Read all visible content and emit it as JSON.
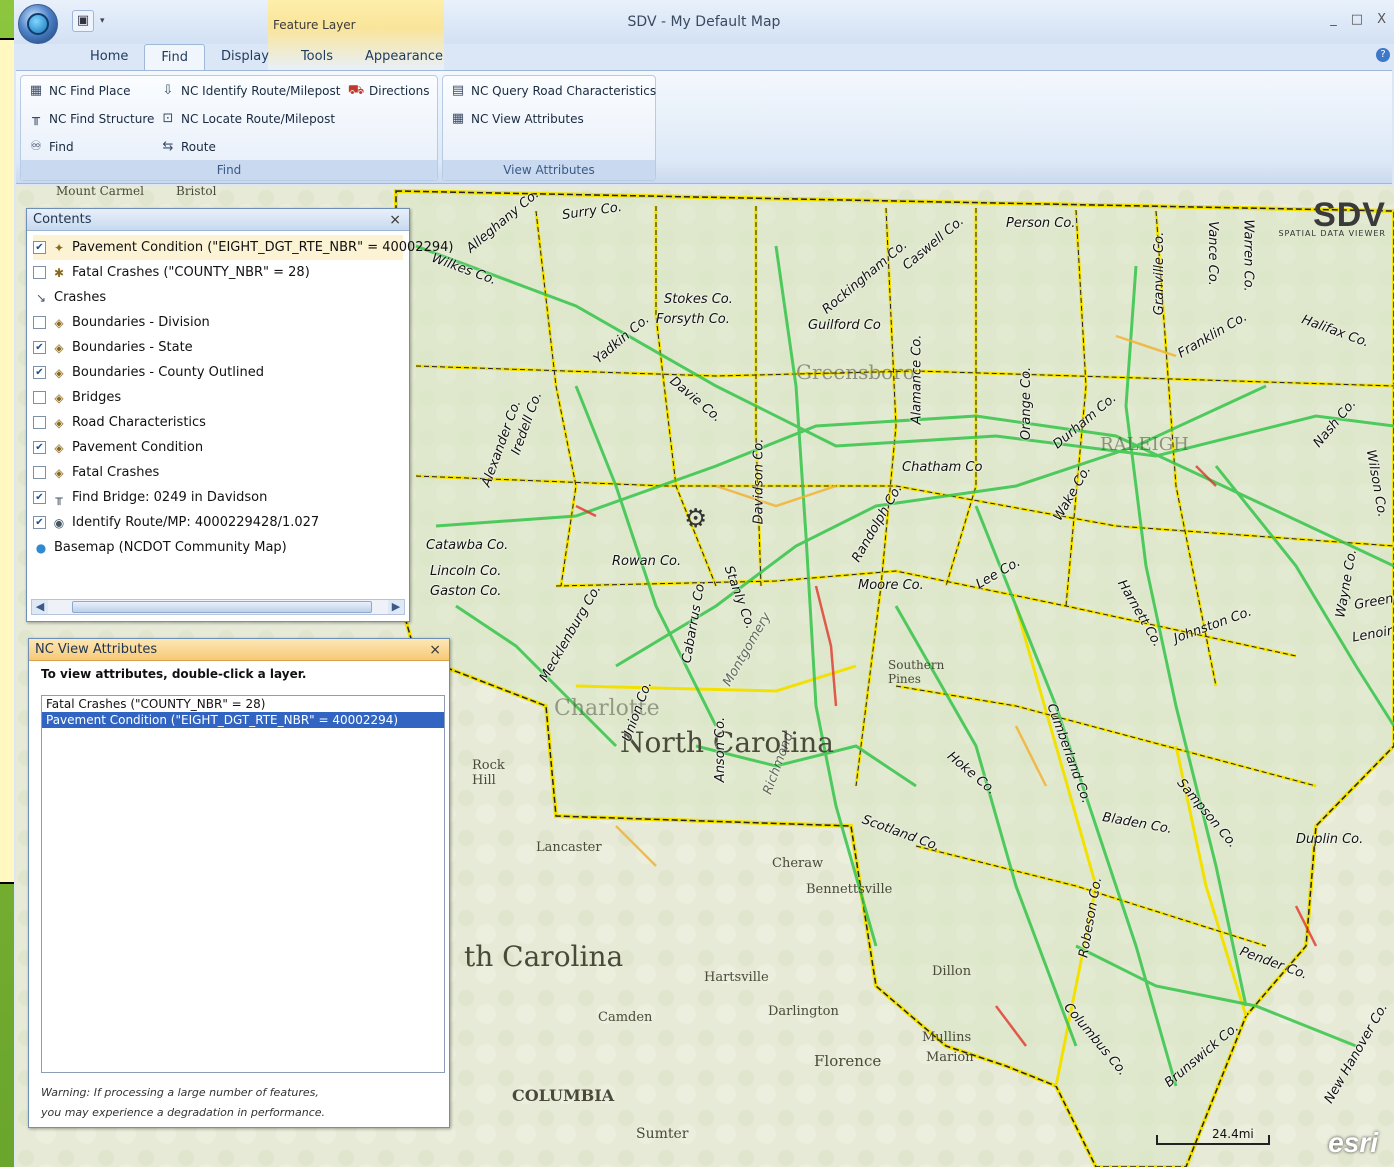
{
  "window": {
    "title": "SDV - My Default Map",
    "context_tab_group": "Feature Layer",
    "controls": {
      "minimize": "_",
      "maximize": "□",
      "close": "X"
    }
  },
  "quick_access": {
    "save_icon": "save-icon",
    "dropdown": "▾"
  },
  "tabs": [
    {
      "label": "Home"
    },
    {
      "label": "Find"
    },
    {
      "label": "Display"
    },
    {
      "label": "Tools"
    },
    {
      "label": "Appearance"
    }
  ],
  "ribbon": {
    "find_group": {
      "label": "Find",
      "items": {
        "find_place": "NC Find Place",
        "identify_route": "NC Identify Route/Milepost",
        "directions": "Directions",
        "find_structure": "NC Find Structure",
        "locate_route": "NC Locate Route/Milepost",
        "find": "Find",
        "route": "Route"
      }
    },
    "view_group": {
      "label": "View Attributes",
      "items": {
        "query_road": "NC Query Road Characteristics",
        "view_attrs": "NC View Attributes"
      }
    }
  },
  "contents": {
    "title": "Contents",
    "close": "×",
    "layers": [
      {
        "label": "Pavement Condition (\"EIGHT_DGT_RTE_NBR\" = 40002294)",
        "checked": true
      },
      {
        "label": "Fatal Crashes (\"COUNTY_NBR\" = 28)",
        "checked": false
      },
      {
        "label": "Crashes",
        "checked": null
      },
      {
        "label": "Boundaries - Division",
        "checked": false
      },
      {
        "label": "Boundaries - State",
        "checked": true
      },
      {
        "label": "Boundaries - County Outlined",
        "checked": true
      },
      {
        "label": "Bridges",
        "checked": false
      },
      {
        "label": "Road Characteristics",
        "checked": false
      },
      {
        "label": "Pavement Condition",
        "checked": true
      },
      {
        "label": "Fatal Crashes",
        "checked": false
      },
      {
        "label": "Find Bridge: 0249 in Davidson",
        "checked": true
      },
      {
        "label": "Identify Route/MP: 4000229428/1.027",
        "checked": true
      },
      {
        "label": "Basemap (NCDOT Community Map)",
        "checked": null
      }
    ]
  },
  "attributes_panel": {
    "title": "NC View Attributes",
    "close": "×",
    "instruction": "To view attributes, double-click a layer.",
    "items": [
      "Fatal Crashes (\"COUNTY_NBR\" = 28)",
      "Pavement Condition (\"EIGHT_DGT_RTE_NBR\" = 40002294)"
    ],
    "warning_line1": "Warning:  If processing a large number of features,",
    "warning_line2": "you may experience a degradation in performance."
  },
  "map": {
    "logo": "SDV",
    "logo_sub": "SPATIAL DATA VIEWER",
    "attribution": "esri",
    "scale": "24.4mi",
    "places": {
      "nc": "North Carolina",
      "sc": "th Carolina",
      "greensboro": "Greensboro",
      "raleigh": "RALEIGH",
      "charlotte": "Charlotte",
      "columbia": "COLUMBIA",
      "florence": "Florence",
      "hartsville": "Hartsville",
      "cheraw": "Cheraw",
      "bennettsville": "Bennettsville",
      "darlington": "Darlington",
      "camden": "Camden",
      "sumter": "Sumter",
      "lancaster": "Lancaster",
      "rock_hill": "Rock Hill",
      "dillon": "Dillon",
      "mullins": "Mullins",
      "marion": "Marion",
      "southern_pines": "Southern Pines",
      "mount_carmel": "Mount Carmel",
      "bristol": "Bristol"
    },
    "counties": [
      "Surry Co.",
      "Alleghany Co.",
      "Wilkes Co.",
      "Stokes Co.",
      "Rockingham Co.",
      "Caswell Co.",
      "Person Co.",
      "Granville Co.",
      "Vance Co.",
      "Warren Co.",
      "Forsyth Co.",
      "Guilford Co",
      "Yadkin Co.",
      "Davie Co.",
      "Alamance Co.",
      "Orange Co.",
      "Durham Co.",
      "Franklin Co.",
      "Halifax Co.",
      "Nash Co.",
      "Wilson Co.",
      "Iredell Co.",
      "Alexander Co.",
      "Rowan Co.",
      "Davidson Co.",
      "Randolph Co.",
      "Chatham Co",
      "Wake Co.",
      "Lee Co.",
      "Harnett Co.",
      "Johnston Co.",
      "Wayne Co.",
      "Moore Co.",
      "Stanly Co.",
      "Cabarrus Co.",
      "Mecklenburg Co.",
      "Union Co.",
      "Anson Co.",
      "Richmond",
      "Montgomery",
      "Hoke Co.",
      "Cumberland Co.",
      "Sampson Co.",
      "Duplin Co.",
      "Bladen Co.",
      "Robeson Co.",
      "Scotland Co.",
      "Columbus Co.",
      "Pender Co.",
      "Brunswick Co.",
      "New Hanover Co.",
      "Lincoln Co.",
      "Gaston Co.",
      "Catawba Co.",
      "Greene",
      "Lenoir C"
    ]
  }
}
